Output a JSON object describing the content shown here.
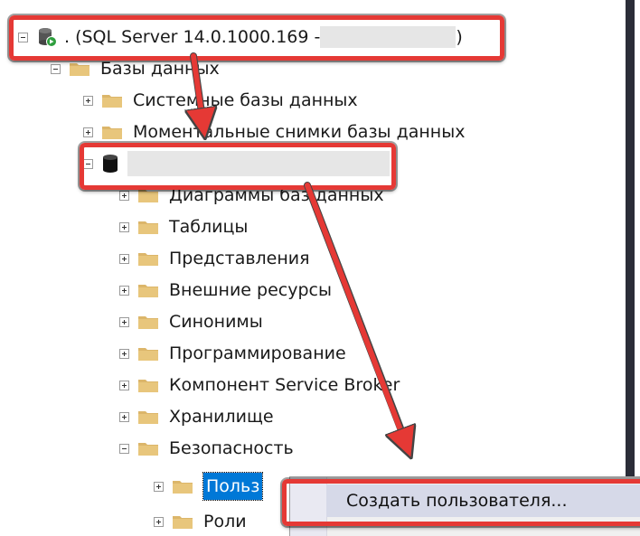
{
  "server_node": {
    "label": ". (SQL Server 14.0.1000.169 - ",
    "close_paren": ")"
  },
  "databases_node": {
    "label": "Базы данных"
  },
  "tree_items": [
    {
      "label": "Системные базы данных"
    },
    {
      "label": "Моментальные снимки базы данных"
    },
    {
      "label": "Диаграммы баз данных"
    },
    {
      "label": "Таблицы"
    },
    {
      "label": "Представления"
    },
    {
      "label": "Внешние ресурсы"
    },
    {
      "label": "Синонимы"
    },
    {
      "label": "Программирование"
    },
    {
      "label": "Компонент Service Broker"
    },
    {
      "label": "Хранилище"
    },
    {
      "label": "Безопасность"
    },
    {
      "label": "Польз"
    },
    {
      "label": "Роли"
    }
  ],
  "context_menu": {
    "items": [
      {
        "label": "Создать пользователя..."
      }
    ]
  },
  "colors": {
    "highlight": "#e53935",
    "selection": "#0078d7",
    "folder": "#dcb66a"
  }
}
